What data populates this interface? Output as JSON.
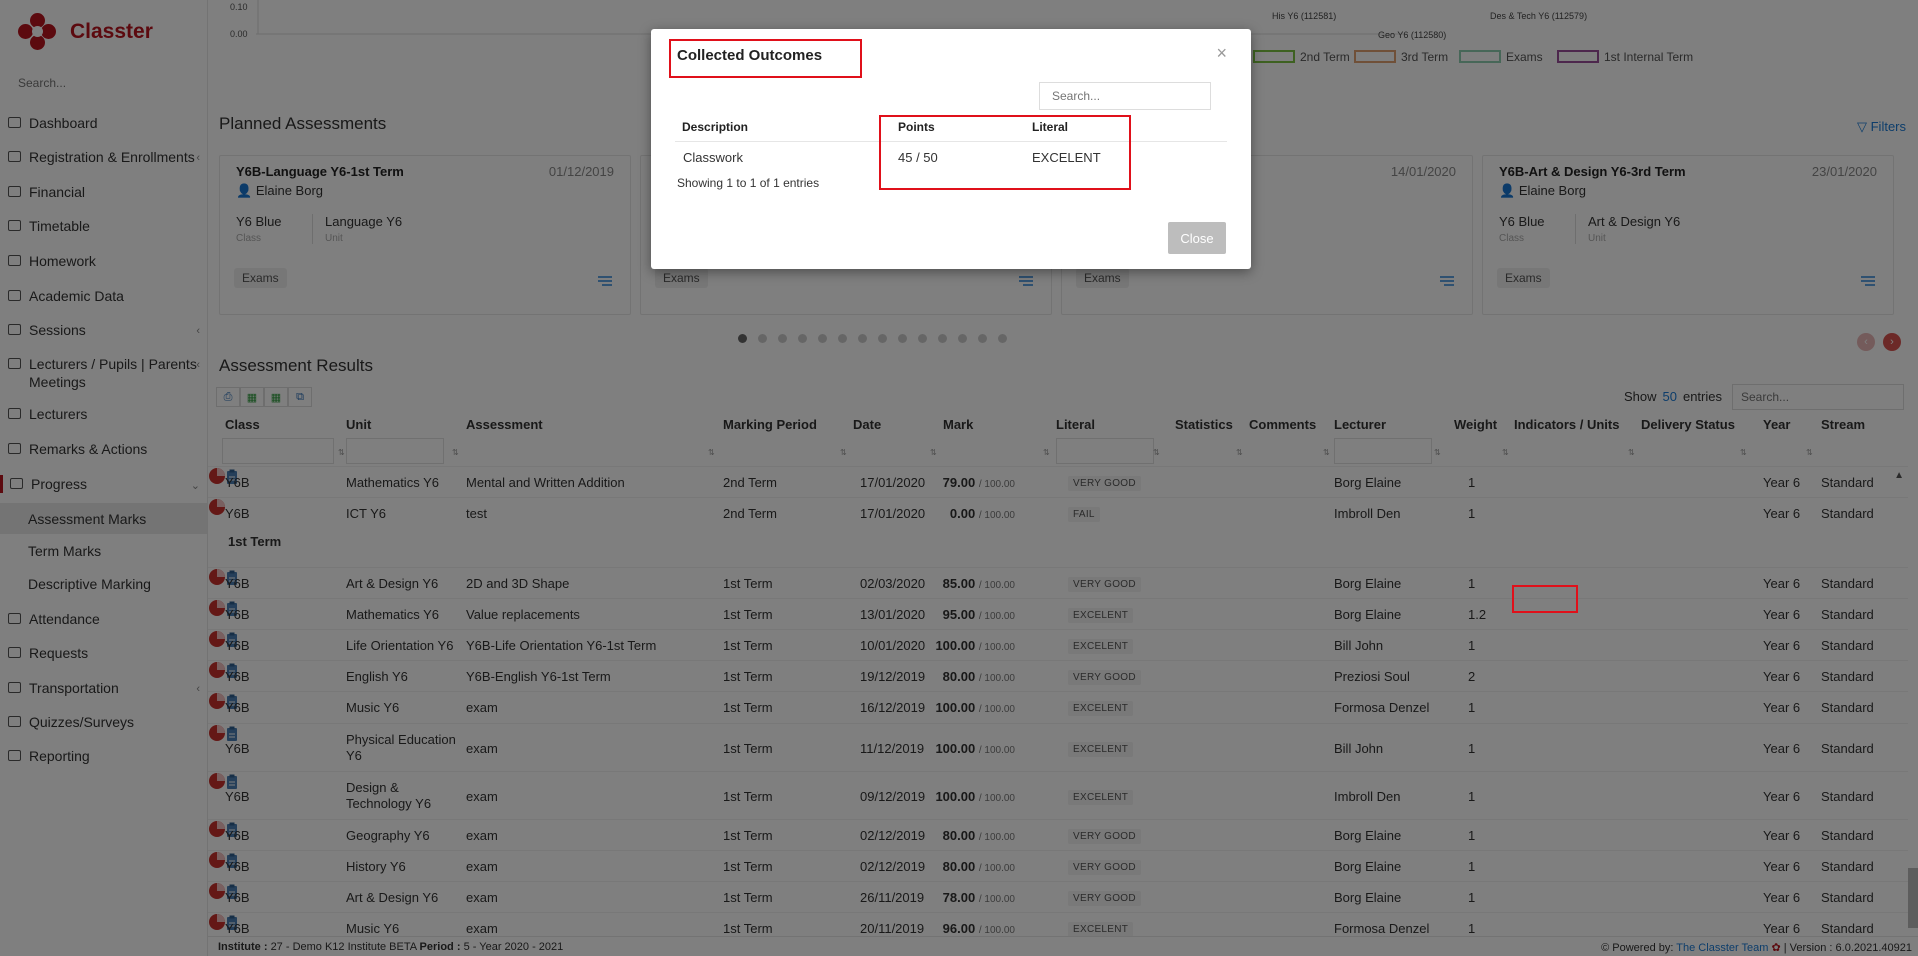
{
  "app": {
    "name": "Classter"
  },
  "sidebar": {
    "search_placeholder": "Search...",
    "items": [
      {
        "label": "Dashboard"
      },
      {
        "label": "Registration & Enrollments"
      },
      {
        "label": "Financial"
      },
      {
        "label": "Timetable"
      },
      {
        "label": "Homework"
      },
      {
        "label": "Academic Data"
      },
      {
        "label": "Sessions"
      },
      {
        "label": "Lecturers / Pupils | Parents Meetings"
      },
      {
        "label": "Lecturers"
      },
      {
        "label": "Remarks & Actions"
      },
      {
        "label": "Progress"
      },
      {
        "label": "Attendance"
      },
      {
        "label": "Requests"
      },
      {
        "label": "Transportation"
      },
      {
        "label": "Quizzes/Surveys"
      },
      {
        "label": "Reporting"
      }
    ],
    "progress_sub": [
      "Assessment Marks",
      "Term Marks",
      "Descriptive Marking"
    ]
  },
  "chart_strip": {
    "y_ticks": [
      "0.10",
      "0.00"
    ],
    "labels": [
      "His Y6 (112581)",
      "Des & Tech Y6 (112579)",
      "Geo Y6 (112580)"
    ],
    "legend": [
      "2nd Term",
      "3rd Term",
      "Exams",
      "1st Internal Term"
    ],
    "legend_colors": [
      "#7dc242",
      "#e0a070",
      "#8fcfb0",
      "#9b4f9b"
    ]
  },
  "planned": {
    "title": "Planned Assessments",
    "filters_label": "Filters",
    "cards": [
      {
        "title": "Y6B-Language Y6-1st Term",
        "date": "01/12/2019",
        "lecturer": "Elaine Borg",
        "class": "Y6 Blue",
        "class_label": "Class",
        "unit": "Language Y6",
        "unit_label": "Unit",
        "badge": "Exams"
      },
      {
        "title": "",
        "date": "",
        "lecturer": "",
        "class": "",
        "class_label": "",
        "unit": "",
        "unit_label": "",
        "badge": "Exams"
      },
      {
        "title": "",
        "date": "14/01/2020",
        "lecturer": "",
        "class": "",
        "class_label": "",
        "unit": "",
        "unit_label": "",
        "badge": "Exams"
      },
      {
        "title": "Y6B-Art & Design Y6-3rd Term",
        "date": "23/01/2020",
        "lecturer": "Elaine Borg",
        "class": "Y6 Blue",
        "class_label": "Class",
        "unit": "Art & Design Y6",
        "unit_label": "Unit",
        "badge": "Exams"
      }
    ],
    "dot_count": 14,
    "dot_active": 0
  },
  "results": {
    "title": "Assessment Results",
    "show_label": "Show",
    "show_value": "50",
    "entries_label": "entries",
    "search_placeholder": "Search...",
    "columns": [
      "Class",
      "Unit",
      "Assessment",
      "Marking Period",
      "Date",
      "Mark",
      "Literal",
      "Statistics",
      "Comments",
      "Lecturer",
      "Weight",
      "Indicators / Units",
      "Delivery Status",
      "Year",
      "Stream"
    ],
    "group_label": "1st Term",
    "rows": [
      {
        "class": "Y6B",
        "unit": "Mathematics Y6",
        "assessment": "Mental and Written Addition",
        "period": "2nd Term",
        "date": "17/01/2020",
        "mark": "79.00",
        "out_of": "/ 100.00",
        "literal": "VERY GOOD",
        "lecturer": "Borg Elaine",
        "weight": "1",
        "has_ind": true,
        "year": "Year 6",
        "stream": "Standard"
      },
      {
        "class": "Y6B",
        "unit": "ICT Y6",
        "assessment": "test",
        "period": "2nd Term",
        "date": "17/01/2020",
        "mark": "0.00",
        "out_of": "/ 100.00",
        "literal": "FAIL",
        "lecturer": "Imbroll Den",
        "weight": "1",
        "has_ind": false,
        "year": "Year 6",
        "stream": "Standard"
      },
      {
        "class": "Y6B",
        "unit": "Art & Design Y6",
        "assessment": "2D and 3D Shape",
        "period": "1st Term",
        "date": "02/03/2020",
        "mark": "85.00",
        "out_of": "/ 100.00",
        "literal": "VERY GOOD",
        "lecturer": "Borg Elaine",
        "weight": "1",
        "has_ind": true,
        "year": "Year 6",
        "stream": "Standard"
      },
      {
        "class": "Y6B",
        "unit": "Mathematics Y6",
        "assessment": "Value replacements",
        "period": "1st Term",
        "date": "13/01/2020",
        "mark": "95.00",
        "out_of": "/ 100.00",
        "literal": "EXCELENT",
        "lecturer": "Borg Elaine",
        "weight": "1.2",
        "has_ind": true,
        "year": "Year 6",
        "stream": "Standard"
      },
      {
        "class": "Y6B",
        "unit": "Life Orientation Y6",
        "assessment": "Y6B-Life Orientation Y6-1st Term",
        "period": "1st Term",
        "date": "10/01/2020",
        "mark": "100.00",
        "out_of": "/ 100.00",
        "literal": "EXCELENT",
        "lecturer": "Bill John",
        "weight": "1",
        "has_ind": true,
        "year": "Year 6",
        "stream": "Standard"
      },
      {
        "class": "Y6B",
        "unit": "English Y6",
        "assessment": "Y6B-English Y6-1st Term",
        "period": "1st Term",
        "date": "19/12/2019",
        "mark": "80.00",
        "out_of": "/ 100.00",
        "literal": "VERY GOOD",
        "lecturer": "Preziosi Soul",
        "weight": "2",
        "has_ind": true,
        "year": "Year 6",
        "stream": "Standard"
      },
      {
        "class": "Y6B",
        "unit": "Music Y6",
        "assessment": "exam",
        "period": "1st Term",
        "date": "16/12/2019",
        "mark": "100.00",
        "out_of": "/ 100.00",
        "literal": "EXCELENT",
        "lecturer": "Formosa Denzel",
        "weight": "1",
        "has_ind": true,
        "year": "Year 6",
        "stream": "Standard"
      },
      {
        "class": "Y6B",
        "unit": "Physical Education Y6",
        "assessment": "exam",
        "period": "1st Term",
        "date": "11/12/2019",
        "mark": "100.00",
        "out_of": "/ 100.00",
        "literal": "EXCELENT",
        "lecturer": "Bill John",
        "weight": "1",
        "has_ind": true,
        "year": "Year 6",
        "stream": "Standard"
      },
      {
        "class": "Y6B",
        "unit": "Design & Technology Y6",
        "assessment": "exam",
        "period": "1st Term",
        "date": "09/12/2019",
        "mark": "100.00",
        "out_of": "/ 100.00",
        "literal": "EXCELENT",
        "lecturer": "Imbroll Den",
        "weight": "1",
        "has_ind": true,
        "year": "Year 6",
        "stream": "Standard"
      },
      {
        "class": "Y6B",
        "unit": "Geography Y6",
        "assessment": "exam",
        "period": "1st Term",
        "date": "02/12/2019",
        "mark": "80.00",
        "out_of": "/ 100.00",
        "literal": "VERY GOOD",
        "lecturer": "Borg Elaine",
        "weight": "1",
        "has_ind": true,
        "year": "Year 6",
        "stream": "Standard"
      },
      {
        "class": "Y6B",
        "unit": "History Y6",
        "assessment": "exam",
        "period": "1st Term",
        "date": "02/12/2019",
        "mark": "80.00",
        "out_of": "/ 100.00",
        "literal": "VERY GOOD",
        "lecturer": "Borg Elaine",
        "weight": "1",
        "has_ind": true,
        "year": "Year 6",
        "stream": "Standard"
      },
      {
        "class": "Y6B",
        "unit": "Art & Design Y6",
        "assessment": "exam",
        "period": "1st Term",
        "date": "26/11/2019",
        "mark": "78.00",
        "out_of": "/ 100.00",
        "literal": "VERY GOOD",
        "lecturer": "Borg Elaine",
        "weight": "1",
        "has_ind": true,
        "year": "Year 6",
        "stream": "Standard"
      },
      {
        "class": "Y6B",
        "unit": "Music Y6",
        "assessment": "exam",
        "period": "1st Term",
        "date": "20/11/2019",
        "mark": "96.00",
        "out_of": "/ 100.00",
        "literal": "EXCELENT",
        "lecturer": "Formosa Denzel",
        "weight": "1",
        "has_ind": true,
        "year": "Year 6",
        "stream": "Standard"
      }
    ]
  },
  "footer": {
    "institute_label": "Institute :",
    "institute_value": "27 - Demo K12 Institute BETA",
    "period_label": "Period :",
    "period_value": "5 - Year 2020 - 2021",
    "powered": "Powered by:",
    "team": "The Classter Team",
    "version": "| Version : 6.0.2021.40921"
  },
  "modal": {
    "title": "Collected Outcomes",
    "search_placeholder": "Search...",
    "columns": [
      "Description",
      "Points",
      "Literal"
    ],
    "rows": [
      {
        "description": "Classwork",
        "points": "45 / 50",
        "literal": "EXCELENT"
      }
    ],
    "info": "Showing 1 to 1 of 1 entries",
    "close_label": "Close",
    "close_icon": "×"
  },
  "colors": {
    "brand": "#b8141f",
    "link": "#1a7bd6",
    "highlight": "#e0101a"
  }
}
